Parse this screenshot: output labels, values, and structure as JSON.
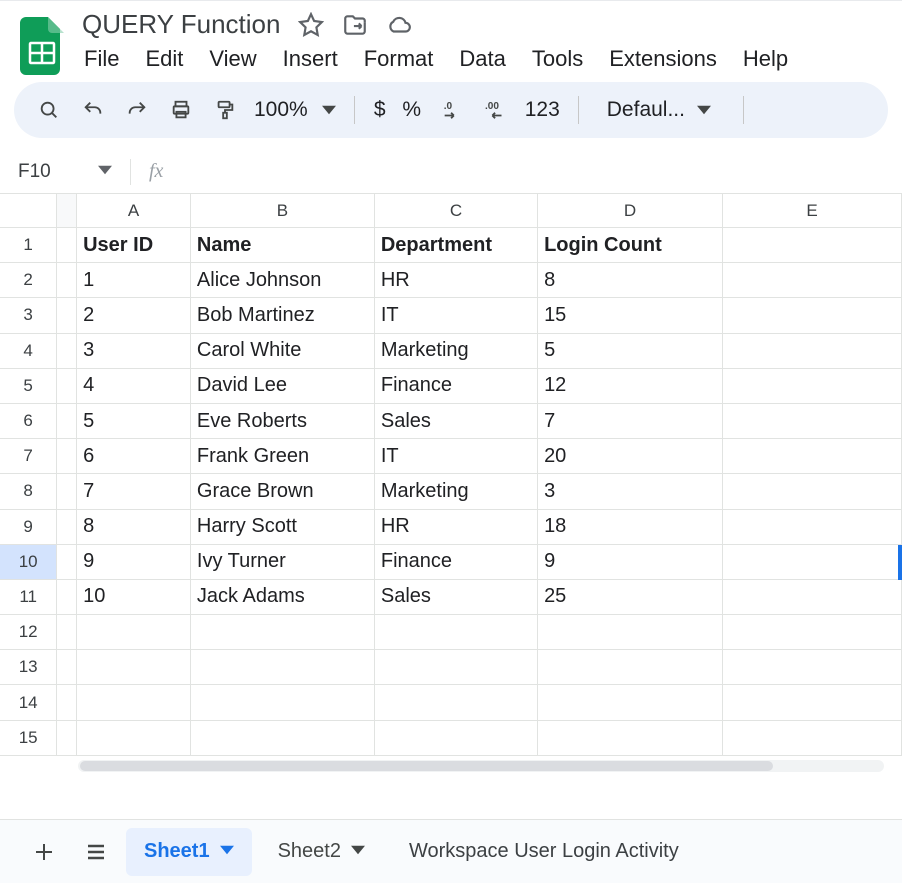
{
  "doc": {
    "title": "QUERY Function"
  },
  "menus": {
    "file": "File",
    "edit": "Edit",
    "view": "View",
    "insert": "Insert",
    "format": "Format",
    "data": "Data",
    "tools": "Tools",
    "extensions": "Extensions",
    "help": "Help"
  },
  "toolbar": {
    "zoom": "100%",
    "currency": "$",
    "percent": "%",
    "decDec": ".0",
    "incDec": ".00",
    "numfmt": "123",
    "font": "Defaul..."
  },
  "formula": {
    "namebox": "F10",
    "fx": "fx",
    "value": ""
  },
  "grid": {
    "columns": [
      "A",
      "B",
      "C",
      "D",
      "E"
    ],
    "rows": [
      "1",
      "2",
      "3",
      "4",
      "5",
      "6",
      "7",
      "8",
      "9",
      "10",
      "11",
      "12",
      "13",
      "14",
      "15"
    ],
    "selectedRow": "10",
    "headerRow": {
      "A": "User ID",
      "B": "Name",
      "C": "Department",
      "D": "Login Count"
    },
    "data": [
      {
        "A": "1",
        "B": "Alice Johnson",
        "C": "HR",
        "D": "8"
      },
      {
        "A": "2",
        "B": "Bob Martinez",
        "C": "IT",
        "D": "15"
      },
      {
        "A": "3",
        "B": "Carol White",
        "C": "Marketing",
        "D": "5"
      },
      {
        "A": "4",
        "B": "David Lee",
        "C": "Finance",
        "D": "12"
      },
      {
        "A": "5",
        "B": "Eve Roberts",
        "C": "Sales",
        "D": "7"
      },
      {
        "A": "6",
        "B": "Frank Green",
        "C": "IT",
        "D": "20"
      },
      {
        "A": "7",
        "B": "Grace Brown",
        "C": "Marketing",
        "D": "3"
      },
      {
        "A": "8",
        "B": "Harry Scott",
        "C": "HR",
        "D": "18"
      },
      {
        "A": "9",
        "B": "Ivy Turner",
        "C": "Finance",
        "D": "9"
      },
      {
        "A": "10",
        "B": "Jack Adams",
        "C": "Sales",
        "D": "25"
      }
    ]
  },
  "tabs": {
    "add": "+",
    "all": "≡",
    "sheet1": "Sheet1",
    "sheet2": "Sheet2",
    "desc": "Workspace User Login Activity"
  }
}
